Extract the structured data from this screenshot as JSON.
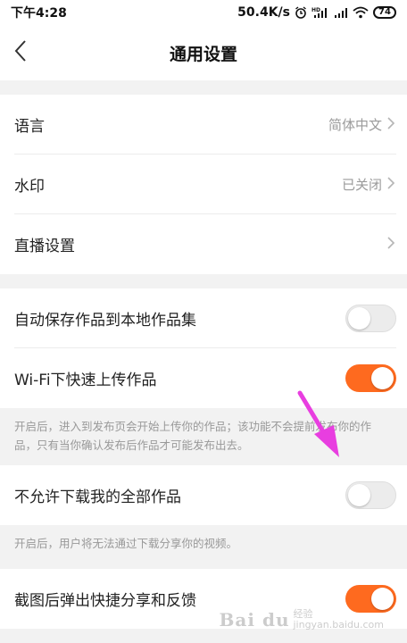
{
  "status_bar": {
    "time": "下午4:28",
    "network_speed": "50.4K/s",
    "network_type": "HD",
    "battery": "74"
  },
  "header": {
    "title": "通用设置",
    "back_icon": "chevron-left-icon"
  },
  "settings_group_1": [
    {
      "label": "语言",
      "value": "简体中文"
    },
    {
      "label": "水印",
      "value": "已关闭"
    },
    {
      "label": "直播设置",
      "value": ""
    }
  ],
  "toggles": {
    "auto_save": {
      "label": "自动保存作品到本地作品集",
      "on": false
    },
    "wifi_upload": {
      "label": "Wi-Fi下快速上传作品",
      "on": true,
      "note": "开启后，进入到发布页会开始上传你的作品；该功能不会提前发布你的作品，只有当你确认发布后作品才可能发布出去。"
    },
    "no_download": {
      "label": "不允许下载我的全部作品",
      "on": false,
      "note": "开启后，用户将无法通过下载分享你的视频。"
    },
    "screenshot_share": {
      "label": "截图后弹出快捷分享和反馈",
      "on": true
    }
  },
  "colors": {
    "toggle_on": "#fe6a1f",
    "annotation_arrow": "#e83ee0"
  },
  "watermark": {
    "logo": "Bai du",
    "sub_line_1": "经验",
    "sub_line_2": "jingyan.baidu.com"
  }
}
